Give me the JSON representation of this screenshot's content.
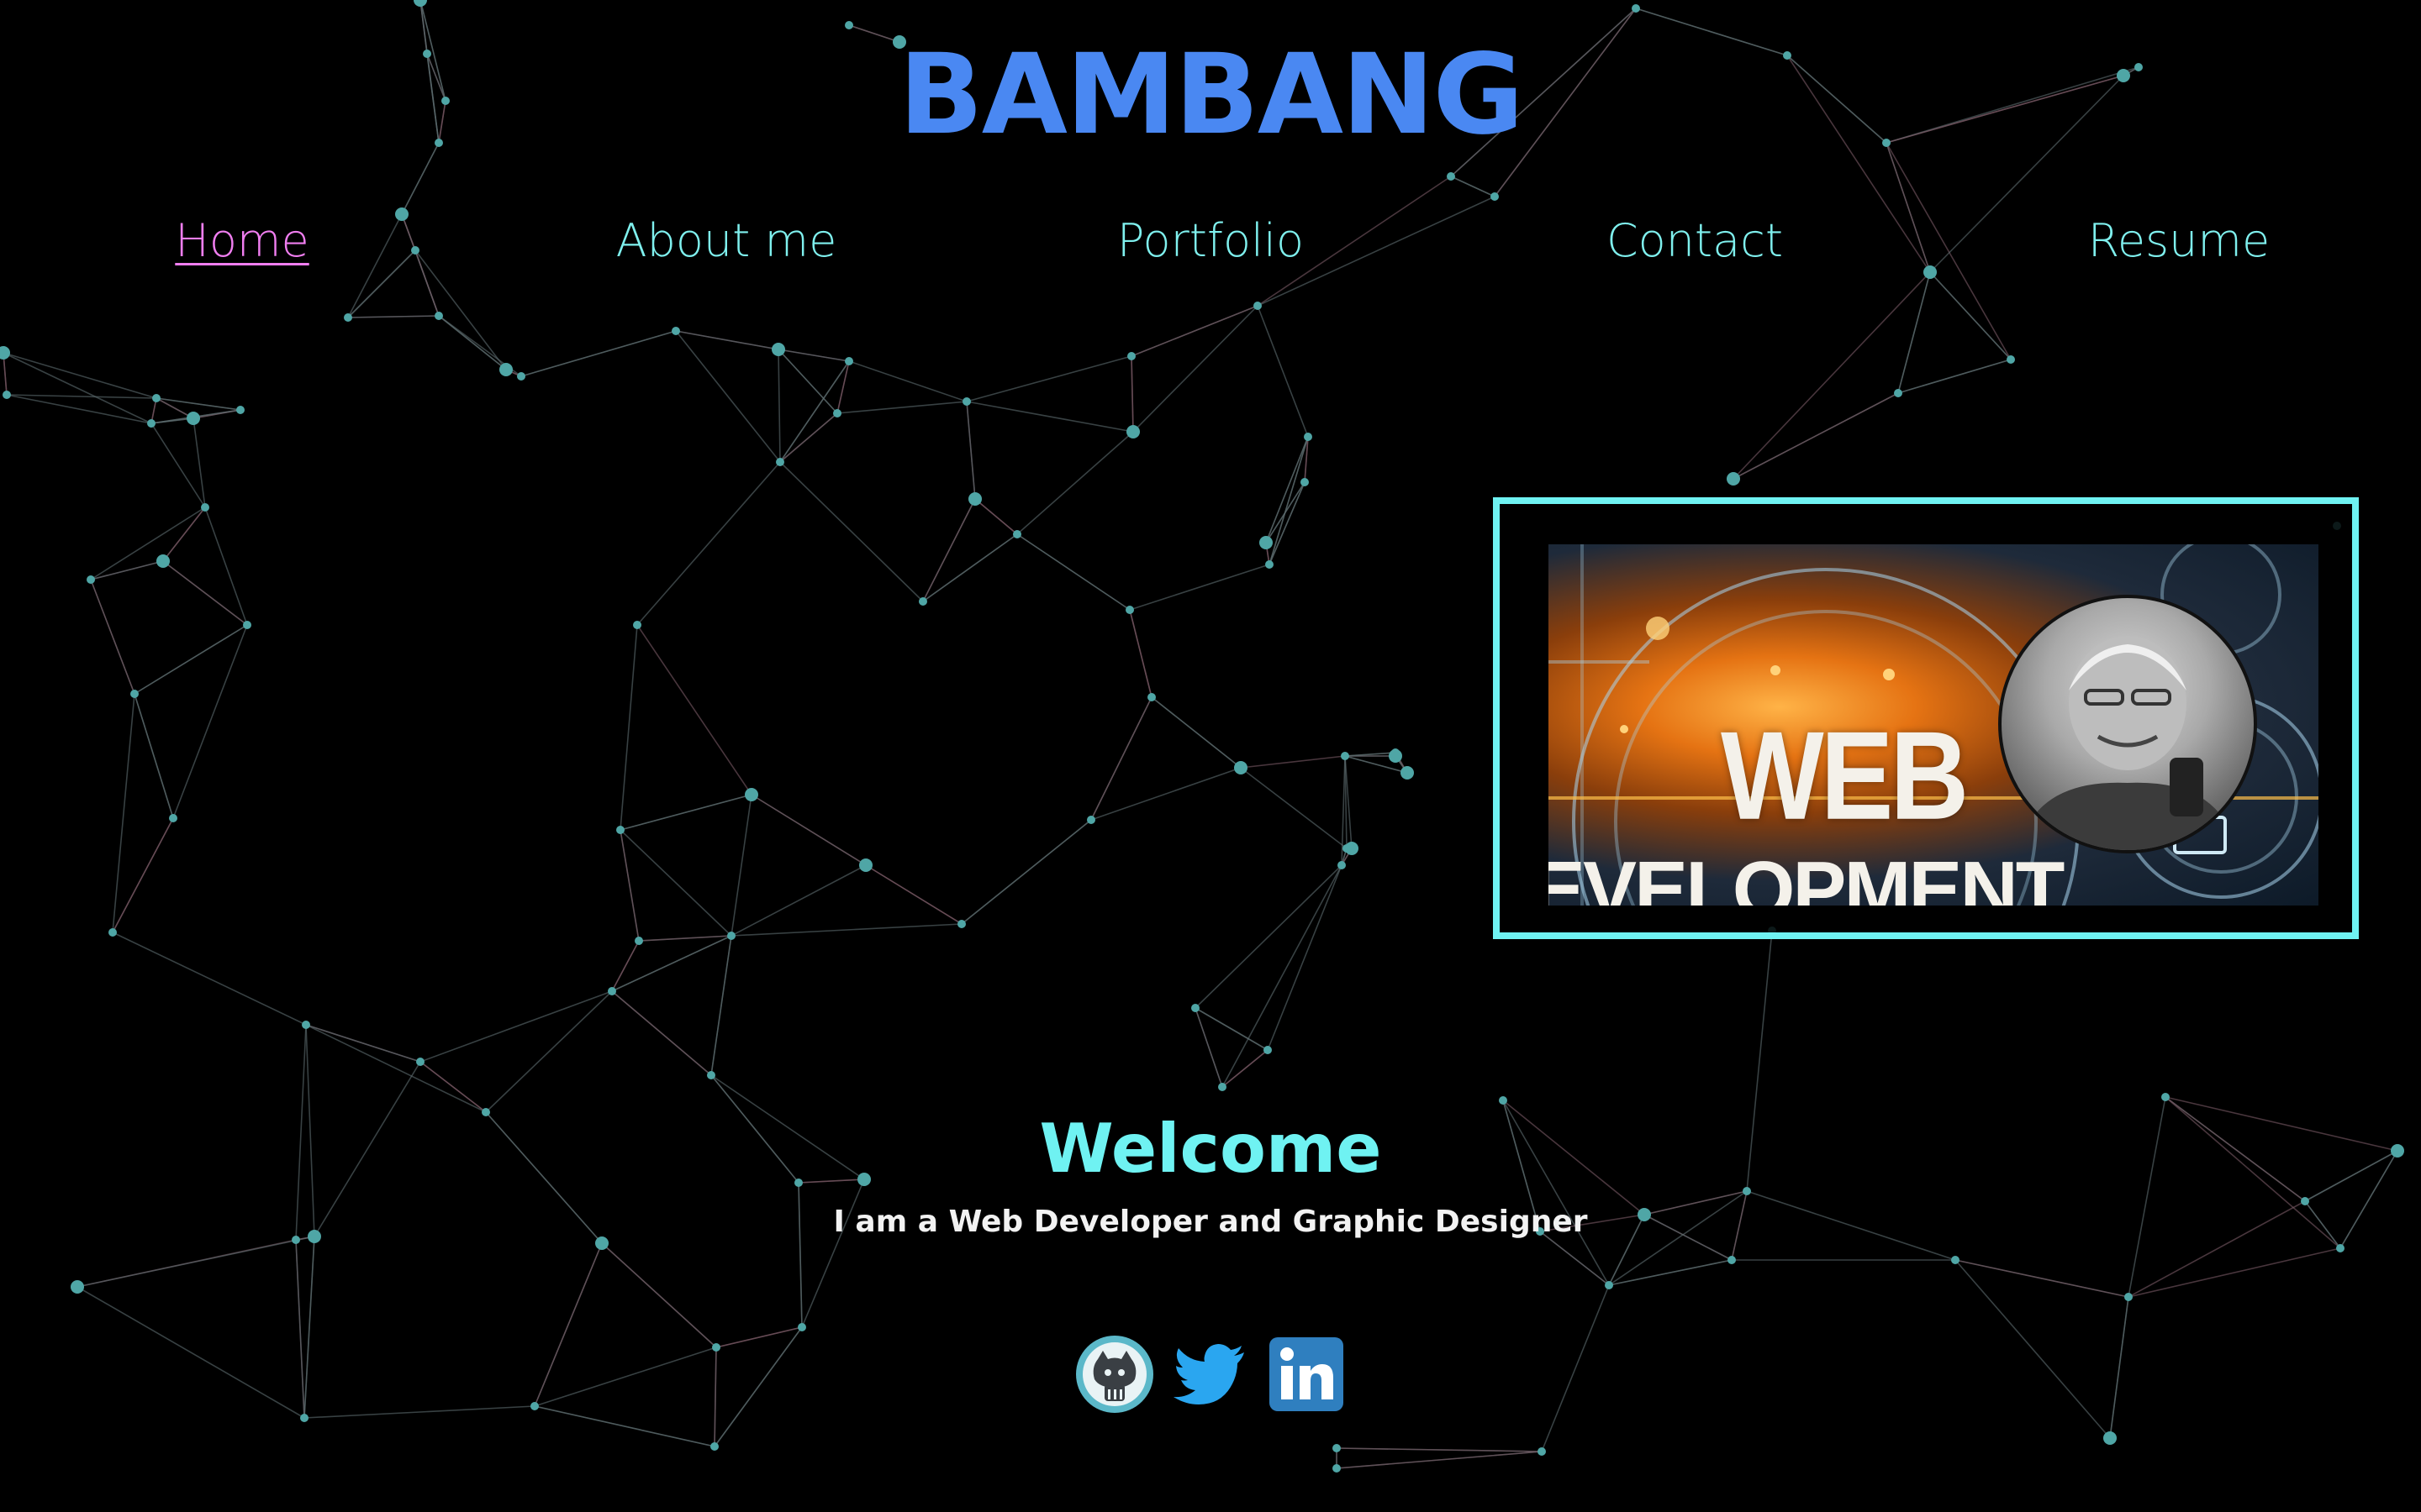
{
  "header": {
    "site_title": "BAMBANG"
  },
  "nav": {
    "items": [
      {
        "label": "Home",
        "active": true
      },
      {
        "label": "About me",
        "active": false
      },
      {
        "label": "Portfolio",
        "active": false
      },
      {
        "label": "Contact",
        "active": false
      },
      {
        "label": "Resume",
        "active": false
      }
    ]
  },
  "hero": {
    "image_line1": "WEB",
    "image_line2": "EVELOPMENT"
  },
  "intro": {
    "heading": "Welcome",
    "tagline": "I am a Web Developer and Graphic Designer"
  },
  "socials": [
    {
      "icon": "github-icon"
    },
    {
      "icon": "twitter-icon"
    },
    {
      "icon": "linkedin-icon"
    }
  ],
  "colors": {
    "background": "#000000",
    "title": "#4a88f2",
    "nav_link": "#7ff0ee",
    "nav_active": "#f07ef0",
    "accent_cyan": "#6ff2f2",
    "network_node": "#4fa6a6",
    "network_line": "#7a5a66"
  }
}
